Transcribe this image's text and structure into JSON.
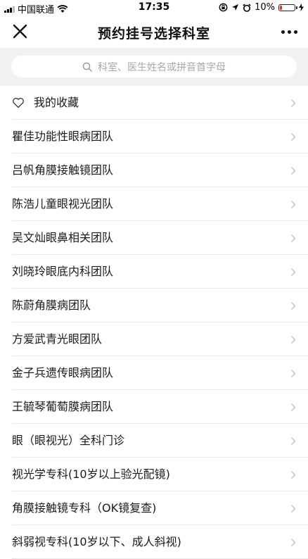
{
  "status_bar": {
    "carrier": "中国联通",
    "time": "17:35",
    "battery": "10%",
    "battery_level": 0.1
  },
  "navbar": {
    "title": "预约挂号选择科室"
  },
  "search": {
    "placeholder": "科室、医生姓名或拼音首字母"
  },
  "favorites": {
    "label": "我的收藏"
  },
  "departments": [
    "瞿佳功能性眼病团队",
    "吕帆角膜接触镜团队",
    "陈浩儿童眼视光团队",
    "吴文灿眼鼻相关团队",
    "刘晓玲眼底内科团队",
    "陈蔚角膜病团队",
    "方爱武青光眼团队",
    "金子兵遗传眼病团队",
    "王毓琴葡萄膜病团队",
    "眼（眼视光）全科门诊",
    "视光学专科(10岁以上验光配镜)",
    "角膜接触镜专科（OK镜复查)",
    "斜弱视专科(10岁以下、成人斜视)"
  ],
  "colors": {
    "battery_low": "#e32222",
    "search_bg": "#f2f2f4",
    "placeholder": "#a8a8a8"
  }
}
